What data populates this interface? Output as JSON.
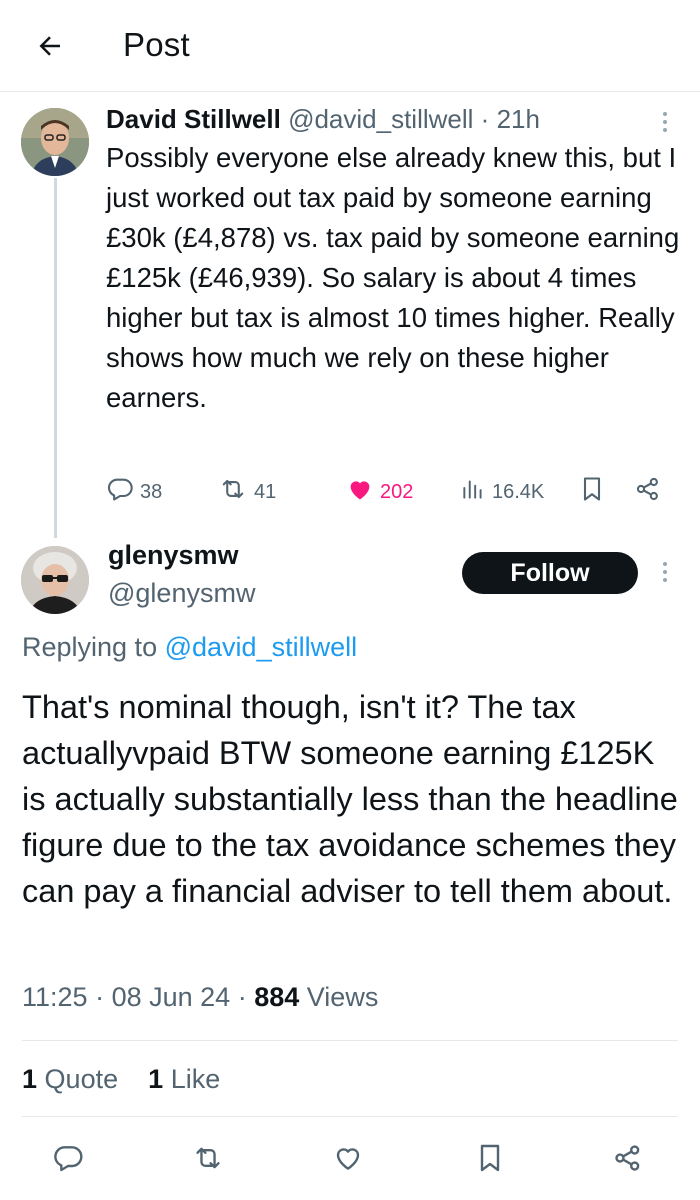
{
  "header": {
    "title": "Post"
  },
  "parent": {
    "name": "David Stillwell",
    "handle": "@david_stillwell",
    "time": "21h",
    "text": "Possibly everyone else already knew this, but I just worked out tax paid by someone earning £30k (£4,878) vs. tax paid by someone earning £125k (£46,939). So salary is about 4 times higher but tax is almost 10 times higher. Really shows how much we rely on these higher earners.",
    "replies": "38",
    "reposts": "41",
    "likes": "202",
    "views": "16.4K"
  },
  "reply": {
    "name": "glenysmw",
    "handle": "@glenysmw",
    "follow_label": "Follow",
    "replying_prefix": "Replying to",
    "replying_to": "@david_stillwell",
    "text": "That's nominal though, isn't it? The tax actuallyvpaid BTW someone earning £125K is actually substantially less than the headline figure due to the tax avoidance schemes they can pay a financial adviser to tell them about.",
    "time": "11:25",
    "date": "08 Jun 24",
    "views_count": "884",
    "views_label": "Views",
    "quotes_count": "1",
    "quotes_label": "Quote",
    "likes_count": "1",
    "likes_label": "Like"
  },
  "colors": {
    "accent": "#1d9bf0",
    "like": "#f91880",
    "muted": "#536471",
    "text": "#0f1419"
  }
}
